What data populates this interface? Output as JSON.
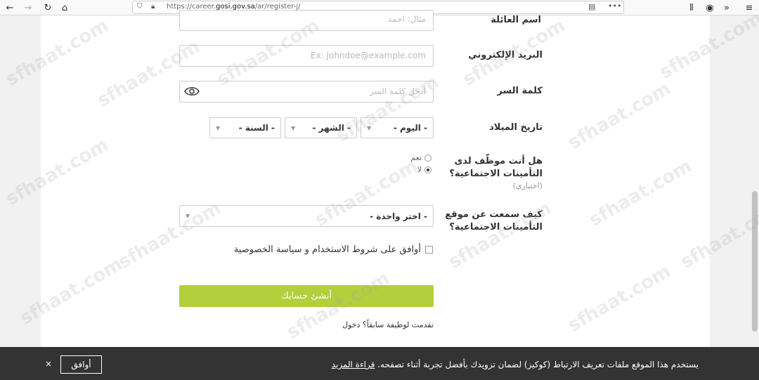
{
  "browser": {
    "url": "https://career.",
    "url_domain": "gosi.gov.sa",
    "url_path": "/ar/register-j/"
  },
  "form": {
    "family_name_label": "اسم العائلة",
    "family_name_placeholder": "مثال: احمد",
    "email_label": "البريد الإلكتروني",
    "email_placeholder": "Ex: Johndoe@example.com",
    "password_label": "كلمة السر",
    "password_placeholder": "أدخل كلمة السر",
    "dob_label": "تاريخ الميلاد",
    "day": "- اليوم -",
    "month": "- الشهر -",
    "year": "- السنة -",
    "employee_label": "هل أنت موظّف لدى التأمينات الاجتماعية؟",
    "optional": "(اختياري)",
    "yes": "نعم",
    "no": "لا",
    "heard_label": "كيف سمعت عن موقع التأمينات الاجتماعية؟",
    "choose_one": "- اختر واحدة -",
    "agree_terms": "أوافق على شروط الاستخدام و سياسة الخصوصية",
    "submit": "أنشئ حسابك",
    "applied_before": "تقدمت لوظيفة سابقاً؟",
    "login": "دخول"
  },
  "cookie": {
    "text": "يستخدم هذا الموقع ملفات تعريف الارتباط (كوكيز) لضمان تزويدك بأفضل تجربة أثناء تصفحه.",
    "read_more": "قراءة المزيد",
    "agree": "أوافق",
    "close": "×"
  },
  "watermark": "sfhaat.com"
}
